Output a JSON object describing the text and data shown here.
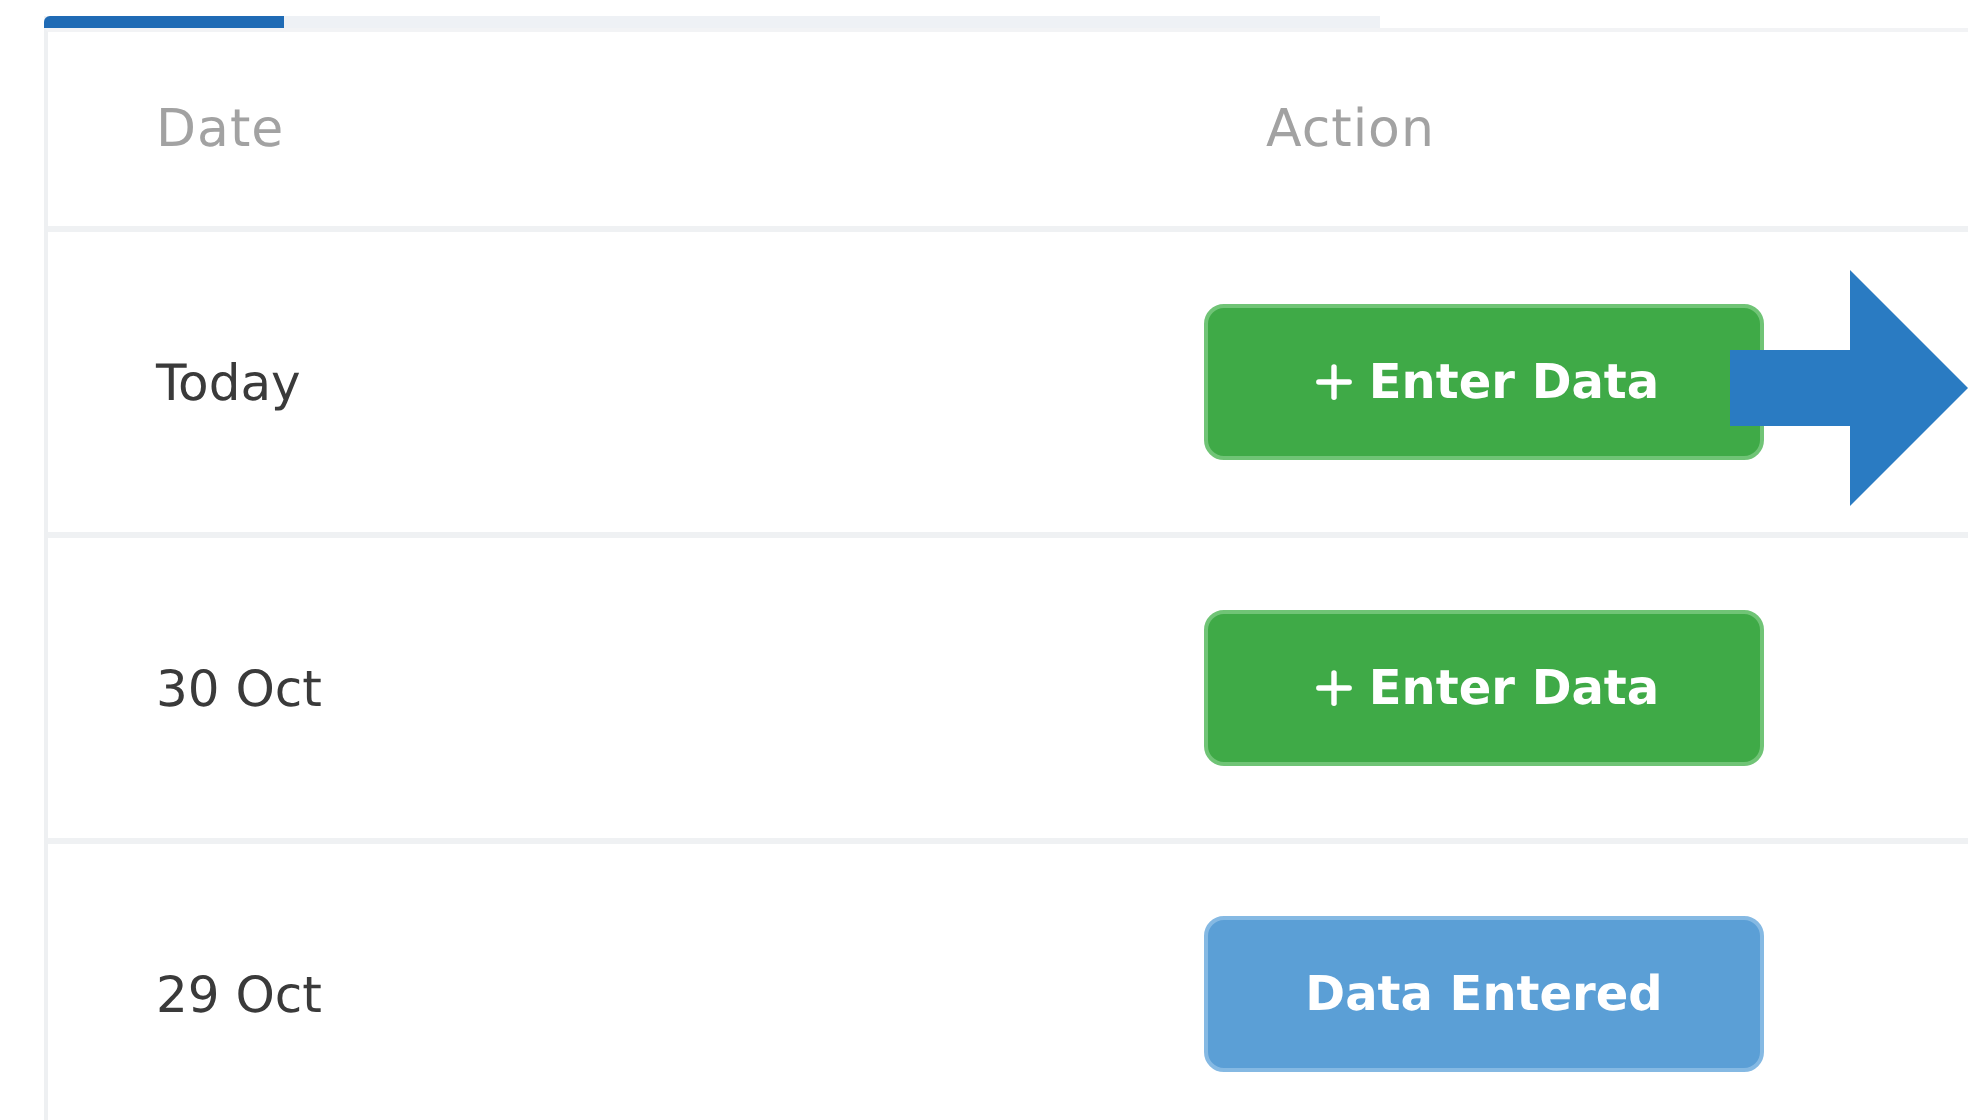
{
  "progress": {
    "level": 0.18
  },
  "table": {
    "columns": [
      "Date",
      "Action"
    ],
    "rows": [
      {
        "date": "Today",
        "action": {
          "kind": "enter",
          "label": "Enter Data"
        }
      },
      {
        "date": "30 Oct",
        "action": {
          "kind": "enter",
          "label": "Enter Data"
        }
      },
      {
        "date": "29 Oct",
        "action": {
          "kind": "entered",
          "label": "Data Entered"
        }
      }
    ]
  },
  "annotation": {
    "kind": "arrow"
  }
}
